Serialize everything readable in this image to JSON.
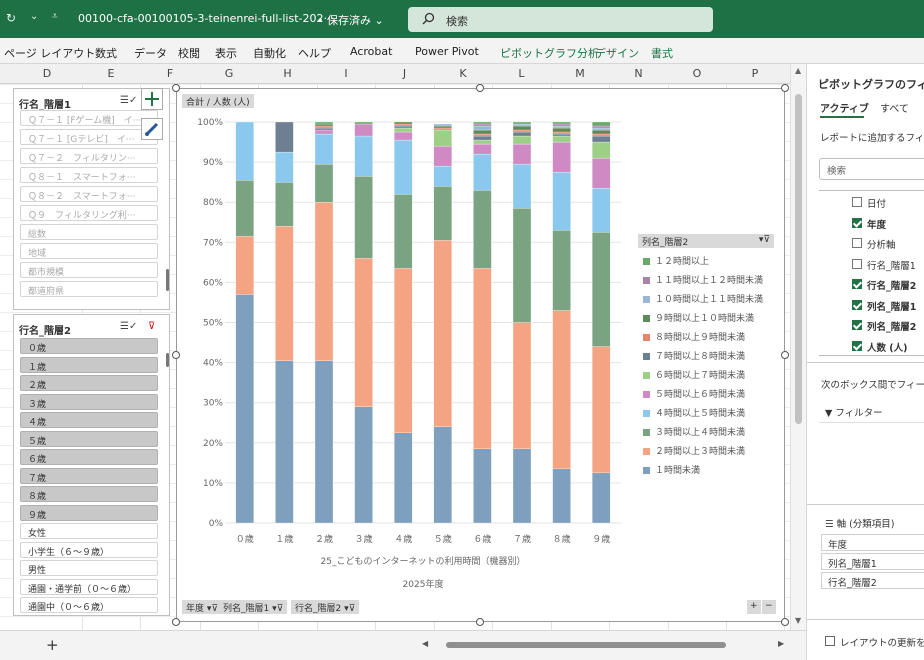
{
  "title_bar": {
    "filename": "00100-cfa-00100105-3-teinenrei-full-list-202···",
    "save_status": "• 保存済み",
    "search_label": "検索"
  },
  "ribbon_tabs": [
    {
      "label": "ページ レイアウト",
      "contextual": false
    },
    {
      "label": "数式",
      "contextual": false
    },
    {
      "label": "データ",
      "contextual": false
    },
    {
      "label": "校閲",
      "contextual": false
    },
    {
      "label": "表示",
      "contextual": false
    },
    {
      "label": "自動化",
      "contextual": false
    },
    {
      "label": "ヘルプ",
      "contextual": false
    },
    {
      "label": "Acrobat",
      "contextual": false
    },
    {
      "label": "Power Pivot",
      "contextual": false
    },
    {
      "label": "ピボットグラフ分析",
      "contextual": true
    },
    {
      "label": "デザイン",
      "contextual": true
    },
    {
      "label": "書式",
      "contextual": true
    }
  ],
  "columns": [
    "D",
    "E",
    "F",
    "G",
    "H",
    "I",
    "J",
    "K",
    "L",
    "M",
    "N",
    "O",
    "P"
  ],
  "slicer1": {
    "header": "行名_階層1",
    "items": [
      {
        "label": "Ｑ７－１ [Fゲーム機]　イ···"
      },
      {
        "label": "Ｑ７－１ [Gテレビ]　イ···"
      },
      {
        "label": "Ｑ７－２　フィルタリン···"
      },
      {
        "label": "Ｑ８－１　スマートフォ···"
      },
      {
        "label": "Ｑ８－２　スマートフォ···"
      },
      {
        "label": "Ｑ９　フィルタリング利···"
      },
      {
        "label": "総数"
      },
      {
        "label": "地域"
      },
      {
        "label": "都市規模"
      },
      {
        "label": "都道府県"
      }
    ]
  },
  "slicer2": {
    "header": "行名_階層2",
    "items": [
      {
        "label": "０歳",
        "selected": true
      },
      {
        "label": "１歳",
        "selected": true
      },
      {
        "label": "２歳",
        "selected": true
      },
      {
        "label": "３歳",
        "selected": true
      },
      {
        "label": "４歳",
        "selected": true
      },
      {
        "label": "５歳",
        "selected": true
      },
      {
        "label": "６歳",
        "selected": true
      },
      {
        "label": "７歳",
        "selected": true
      },
      {
        "label": "８歳",
        "selected": true
      },
      {
        "label": "９歳",
        "selected": true
      },
      {
        "label": "女性",
        "selected": false
      },
      {
        "label": "小学生（６〜９歳）",
        "selected": false
      },
      {
        "label": "男性",
        "selected": false
      },
      {
        "label": "通園・通学前（０〜６歳）",
        "selected": false
      },
      {
        "label": "通園中（０〜６歳）",
        "selected": false
      }
    ]
  },
  "chart_data": {
    "type": "bar",
    "stacked": true,
    "percent": true,
    "value_field_label": "合計 / 人数 (人)",
    "xlabel": "25_こどものインターネットの利用時間（機器別）",
    "xlabel2": "2025年度",
    "ylim": [
      0,
      100
    ],
    "yticks": [
      "0%",
      "10%",
      "20%",
      "30%",
      "40%",
      "50%",
      "60%",
      "70%",
      "80%",
      "90%",
      "100%"
    ],
    "grid": true,
    "legend_title": "列名_階層2",
    "legend_position": "right",
    "categories": [
      "０歳",
      "１歳",
      "２歳",
      "３歳",
      "４歳",
      "５歳",
      "６歳",
      "７歳",
      "８歳",
      "９歳"
    ],
    "series": [
      {
        "name": "１時間未満",
        "color": "#7f9fbe",
        "values": [
          57,
          40.5,
          40.5,
          29,
          22.5,
          24,
          18.5,
          18.5,
          13.5,
          12.5
        ]
      },
      {
        "name": "２時間以上３時間未満",
        "color": "#f4a482",
        "values": [
          14.5,
          33.5,
          39.5,
          37,
          41,
          46.5,
          45,
          31.5,
          39.5,
          31.5
        ]
      },
      {
        "name": "３時間以上４時間未満",
        "color": "#7aa382",
        "values": [
          14,
          11,
          9.5,
          20.5,
          18.5,
          13.5,
          19.5,
          28.5,
          20,
          28.5
        ]
      },
      {
        "name": "４時間以上５時間未満",
        "color": "#8ac8ee",
        "values": [
          14.5,
          7.5,
          7.5,
          10,
          13.5,
          5,
          9,
          11,
          14.5,
          11
        ]
      },
      {
        "name": "５時間以上６時間未満",
        "color": "#cf8ac4",
        "values": [
          0,
          0,
          1,
          3,
          2,
          5,
          2.5,
          5,
          7.5,
          7.5
        ]
      },
      {
        "name": "６時間以上７時間未満",
        "color": "#9dcf86",
        "values": [
          0,
          0,
          0,
          0,
          1,
          4,
          1,
          2,
          1.5,
          4
        ]
      },
      {
        "name": "７時間以上８時間未満",
        "color": "#6e7f92",
        "values": [
          0,
          7.5,
          0.5,
          0,
          0.5,
          0,
          1,
          1,
          0.5,
          1.5
        ]
      },
      {
        "name": "８時間以上９時間未満",
        "color": "#e5856a",
        "values": [
          0,
          0,
          0.5,
          0,
          0.5,
          0.5,
          0.5,
          0.5,
          0.5,
          0.5
        ]
      },
      {
        "name": "９時間以上１０時間未満",
        "color": "#5e8a5a",
        "values": [
          0,
          0,
          0.5,
          0,
          0.5,
          0.5,
          1,
          1,
          1,
          1
        ]
      },
      {
        "name": "１０時間以上１１時間未満",
        "color": "#9bb6d4",
        "values": [
          0,
          0,
          0,
          0,
          0,
          0.5,
          1,
          0.5,
          0.5,
          0.5
        ]
      },
      {
        "name": "１１時間以上１２時間未満",
        "color": "#a883a6",
        "values": [
          0,
          0,
          0,
          0,
          0,
          0,
          0.5,
          0,
          0.5,
          0.5
        ]
      },
      {
        "name": "１２時間以上",
        "color": "#6aa86a",
        "values": [
          0,
          0,
          0.5,
          0.5,
          0,
          0,
          0.5,
          0.5,
          0.5,
          1
        ]
      }
    ]
  },
  "field_buttons": [
    {
      "label": "年度"
    },
    {
      "label": "列名_階層1"
    },
    {
      "label": "行名_階層2"
    }
  ],
  "field_pane": {
    "title": "ピボットグラフのフィール",
    "tab_active": "アクティブ",
    "tab_all": "すべて",
    "add_fields_label": "レポートに追加するフィール",
    "search_placeholder": "検索",
    "fields": [
      {
        "label": "日付",
        "checked": false
      },
      {
        "label": "年度",
        "checked": true
      },
      {
        "label": "分析軸",
        "checked": false
      },
      {
        "label": "行名_階層1",
        "checked": false
      },
      {
        "label": "行名_階層2",
        "checked": true
      },
      {
        "label": "列名_階層1",
        "checked": true
      },
      {
        "label": "列名_階層2",
        "checked": true
      },
      {
        "label": "人数 (人)",
        "checked": true
      }
    ],
    "drag_label": "次のボックス間でフィールドを",
    "filter_label": "フィルター",
    "axis_label": "軸 (分類項目)",
    "axis_items": [
      {
        "label": "年度"
      },
      {
        "label": "列名_階層1"
      },
      {
        "label": "行名_階層2"
      }
    ],
    "defer_label": "レイアウトの更新を保"
  },
  "sheet_bar": {
    "add_sheet": "+"
  }
}
